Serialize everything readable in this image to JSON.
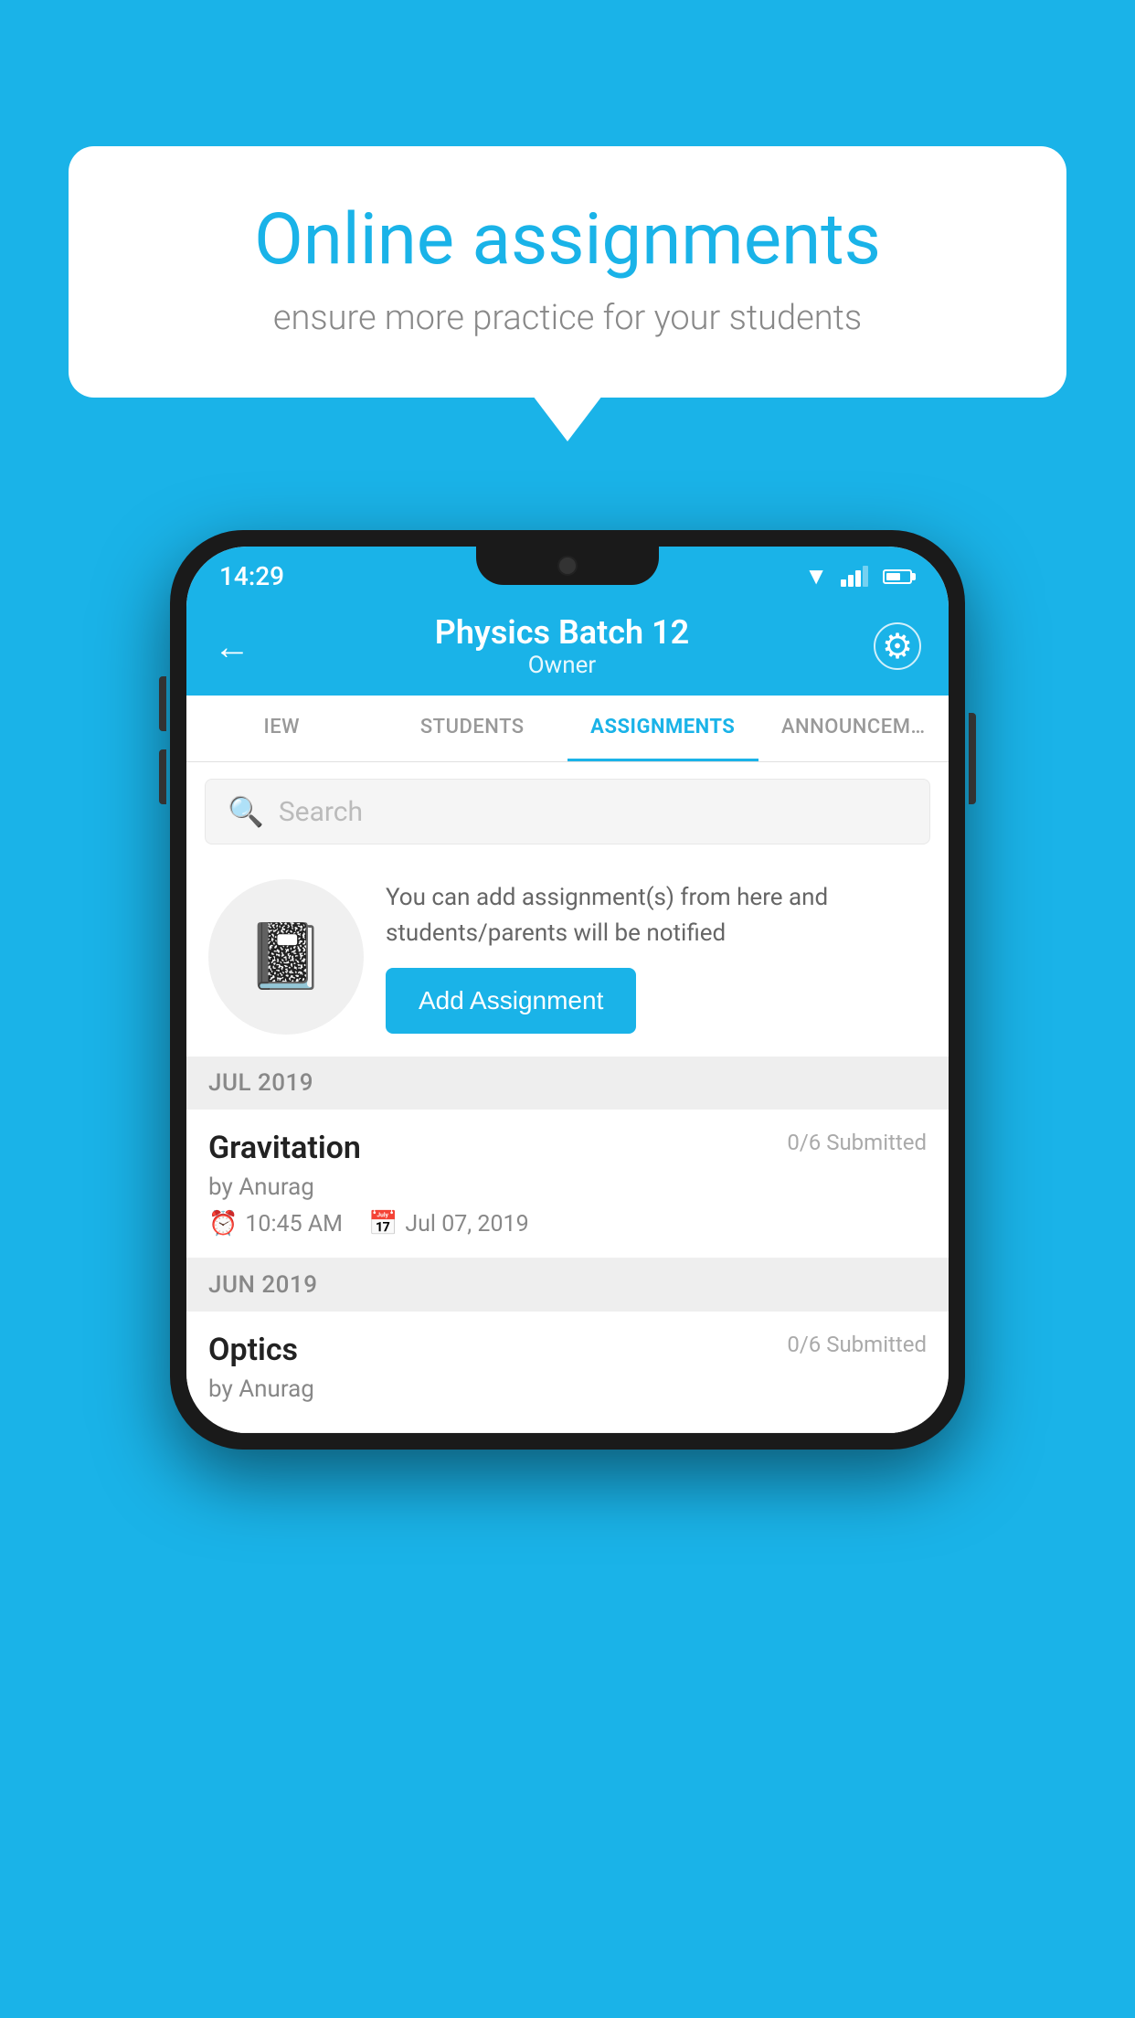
{
  "background_color": "#1ab3e8",
  "speech_bubble": {
    "title": "Online assignments",
    "subtitle": "ensure more practice for your students"
  },
  "status_bar": {
    "time": "14:29",
    "wifi": true,
    "signal": true,
    "battery": true
  },
  "app_header": {
    "title": "Physics Batch 12",
    "subtitle": "Owner",
    "back_label": "←",
    "gear_label": "⚙"
  },
  "tabs": [
    {
      "id": "iew",
      "label": "IEW",
      "active": false
    },
    {
      "id": "students",
      "label": "STUDENTS",
      "active": false
    },
    {
      "id": "assignments",
      "label": "ASSIGNMENTS",
      "active": true
    },
    {
      "id": "announcements",
      "label": "ANNOUNCEM…",
      "active": false
    }
  ],
  "search": {
    "placeholder": "Search"
  },
  "promo": {
    "description": "You can add assignment(s) from here and students/parents will be notified",
    "button_label": "Add Assignment"
  },
  "sections": [
    {
      "month_label": "JUL 2019",
      "assignments": [
        {
          "name": "Gravitation",
          "submitted": "0/6 Submitted",
          "by": "by Anurag",
          "time": "10:45 AM",
          "date": "Jul 07, 2019"
        }
      ]
    },
    {
      "month_label": "JUN 2019",
      "assignments": [
        {
          "name": "Optics",
          "submitted": "0/6 Submitted",
          "by": "by Anurag",
          "time": "",
          "date": ""
        }
      ]
    }
  ]
}
